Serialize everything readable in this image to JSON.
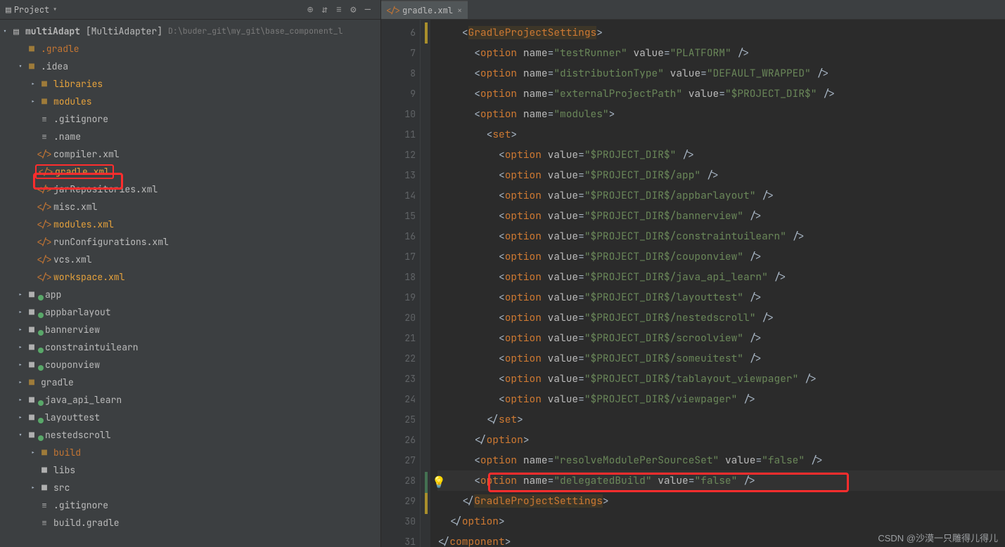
{
  "project_panel": {
    "title": "Project",
    "toolbar_icons": [
      "target-icon",
      "sort-icon",
      "collapse-icon",
      "gear-icon",
      "hide-icon"
    ],
    "root": {
      "name": "multiAdapt",
      "bracket": "[MultiAdapter]",
      "path": "D:\\buder_git\\my_git\\base_component_l"
    },
    "tree": [
      {
        "depth": 1,
        "arrow": "",
        "icon": "fold",
        "label": ".gradle",
        "cls": "org"
      },
      {
        "depth": 1,
        "arrow": "v",
        "icon": "fold",
        "label": ".idea",
        "cls": ""
      },
      {
        "depth": 2,
        "arrow": ">",
        "icon": "fold",
        "label": "libraries",
        "cls": "sel"
      },
      {
        "depth": 2,
        "arrow": ">",
        "icon": "fold",
        "label": "modules",
        "cls": "sel"
      },
      {
        "depth": 2,
        "arrow": "",
        "icon": "txt",
        "label": ".gitignore",
        "cls": ""
      },
      {
        "depth": 2,
        "arrow": "",
        "icon": "txt",
        "label": ".name",
        "cls": ""
      },
      {
        "depth": 2,
        "arrow": "",
        "icon": "xml",
        "label": "compiler.xml",
        "cls": ""
      },
      {
        "depth": 2,
        "arrow": "",
        "icon": "xml",
        "label": "gradle.xml",
        "cls": "sel",
        "boxed": true
      },
      {
        "depth": 2,
        "arrow": "",
        "icon": "xml",
        "label": "jarRepositories.xml",
        "cls": ""
      },
      {
        "depth": 2,
        "arrow": "",
        "icon": "xml",
        "label": "misc.xml",
        "cls": ""
      },
      {
        "depth": 2,
        "arrow": "",
        "icon": "xml",
        "label": "modules.xml",
        "cls": "sel"
      },
      {
        "depth": 2,
        "arrow": "",
        "icon": "xml",
        "label": "runConfigurations.xml",
        "cls": ""
      },
      {
        "depth": 2,
        "arrow": "",
        "icon": "xml",
        "label": "vcs.xml",
        "cls": ""
      },
      {
        "depth": 2,
        "arrow": "",
        "icon": "xml",
        "label": "workspace.xml",
        "cls": "sel"
      },
      {
        "depth": 1,
        "arrow": ">",
        "icon": "foldg",
        "label": "app",
        "cls": ""
      },
      {
        "depth": 1,
        "arrow": ">",
        "icon": "foldg",
        "label": "appbarlayout",
        "cls": ""
      },
      {
        "depth": 1,
        "arrow": ">",
        "icon": "foldg",
        "label": "bannerview",
        "cls": ""
      },
      {
        "depth": 1,
        "arrow": ">",
        "icon": "foldg",
        "label": "constraintuilearn",
        "cls": ""
      },
      {
        "depth": 1,
        "arrow": ">",
        "icon": "foldg",
        "label": "couponview",
        "cls": ""
      },
      {
        "depth": 1,
        "arrow": ">",
        "icon": "fold",
        "label": "gradle",
        "cls": ""
      },
      {
        "depth": 1,
        "arrow": ">",
        "icon": "foldg",
        "label": "java_api_learn",
        "cls": ""
      },
      {
        "depth": 1,
        "arrow": ">",
        "icon": "foldg",
        "label": "layouttest",
        "cls": ""
      },
      {
        "depth": 1,
        "arrow": "v",
        "icon": "foldg",
        "label": "nestedscroll",
        "cls": ""
      },
      {
        "depth": 2,
        "arrow": ">",
        "icon": "fold",
        "label": "build",
        "cls": "org"
      },
      {
        "depth": 2,
        "arrow": "",
        "icon": "foldb",
        "label": "libs",
        "cls": ""
      },
      {
        "depth": 2,
        "arrow": ">",
        "icon": "foldb",
        "label": "src",
        "cls": ""
      },
      {
        "depth": 2,
        "arrow": "",
        "icon": "txt",
        "label": ".gitignore",
        "cls": ""
      },
      {
        "depth": 2,
        "arrow": "",
        "icon": "txt",
        "label": "build.gradle",
        "cls": ""
      }
    ]
  },
  "editor": {
    "tab": {
      "label": "gradle.xml"
    },
    "first_line": 6,
    "lines": [
      {
        "html": "<span class='b'>&lt;</span><span class='t hlbg'>GradleProjectSettings</span><span class='b'>&gt;</span>",
        "indent": 2
      },
      {
        "html": "<span class='b'>&lt;</span><span class='t'>option </span><span class='a'>name</span><span class='eq'>=</span><span class='s'>\"testRunner\"</span> <span class='a'>value</span><span class='eq'>=</span><span class='s'>\"PLATFORM\"</span> <span class='b'>/&gt;</span>",
        "indent": 3
      },
      {
        "html": "<span class='b'>&lt;</span><span class='t'>option </span><span class='a'>name</span><span class='eq'>=</span><span class='s'>\"distributionType\"</span> <span class='a'>value</span><span class='eq'>=</span><span class='s'>\"DEFAULT_WRAPPED\"</span> <span class='b'>/&gt;</span>",
        "indent": 3
      },
      {
        "html": "<span class='b'>&lt;</span><span class='t'>option </span><span class='a'>name</span><span class='eq'>=</span><span class='s'>\"externalProjectPath\"</span> <span class='a'>value</span><span class='eq'>=</span><span class='s'>\"$PROJECT_DIR$\"</span> <span class='b'>/&gt;</span>",
        "indent": 3
      },
      {
        "html": "<span class='b'>&lt;</span><span class='t'>option </span><span class='a'>name</span><span class='eq'>=</span><span class='s'>\"modules\"</span><span class='b'>&gt;</span>",
        "indent": 3
      },
      {
        "html": "<span class='b'>&lt;</span><span class='t'>set</span><span class='b'>&gt;</span>",
        "indent": 4
      },
      {
        "html": "<span class='b'>&lt;</span><span class='t'>option </span><span class='a'>value</span><span class='eq'>=</span><span class='s'>\"$PROJECT_DIR$\"</span> <span class='b'>/&gt;</span>",
        "indent": 5
      },
      {
        "html": "<span class='b'>&lt;</span><span class='t'>option </span><span class='a'>value</span><span class='eq'>=</span><span class='s'>\"$PROJECT_DIR$/app\"</span> <span class='b'>/&gt;</span>",
        "indent": 5
      },
      {
        "html": "<span class='b'>&lt;</span><span class='t'>option </span><span class='a'>value</span><span class='eq'>=</span><span class='s'>\"$PROJECT_DIR$/appbarlayout\"</span> <span class='b'>/&gt;</span>",
        "indent": 5
      },
      {
        "html": "<span class='b'>&lt;</span><span class='t'>option </span><span class='a'>value</span><span class='eq'>=</span><span class='s'>\"$PROJECT_DIR$/bannerview\"</span> <span class='b'>/&gt;</span>",
        "indent": 5
      },
      {
        "html": "<span class='b'>&lt;</span><span class='t'>option </span><span class='a'>value</span><span class='eq'>=</span><span class='s'>\"$PROJECT_DIR$/constraintuilearn\"</span> <span class='b'>/&gt;</span>",
        "indent": 5
      },
      {
        "html": "<span class='b'>&lt;</span><span class='t'>option </span><span class='a'>value</span><span class='eq'>=</span><span class='s'>\"$PROJECT_DIR$/couponview\"</span> <span class='b'>/&gt;</span>",
        "indent": 5
      },
      {
        "html": "<span class='b'>&lt;</span><span class='t'>option </span><span class='a'>value</span><span class='eq'>=</span><span class='s'>\"$PROJECT_DIR$/java_api_learn\"</span> <span class='b'>/&gt;</span>",
        "indent": 5
      },
      {
        "html": "<span class='b'>&lt;</span><span class='t'>option </span><span class='a'>value</span><span class='eq'>=</span><span class='s'>\"$PROJECT_DIR$/layouttest\"</span> <span class='b'>/&gt;</span>",
        "indent": 5
      },
      {
        "html": "<span class='b'>&lt;</span><span class='t'>option </span><span class='a'>value</span><span class='eq'>=</span><span class='s'>\"$PROJECT_DIR$/nestedscroll\"</span> <span class='b'>/&gt;</span>",
        "indent": 5
      },
      {
        "html": "<span class='b'>&lt;</span><span class='t'>option </span><span class='a'>value</span><span class='eq'>=</span><span class='s'>\"$PROJECT_DIR$/scroolview\"</span> <span class='b'>/&gt;</span>",
        "indent": 5
      },
      {
        "html": "<span class='b'>&lt;</span><span class='t'>option </span><span class='a'>value</span><span class='eq'>=</span><span class='s'>\"$PROJECT_DIR$/someuitest\"</span> <span class='b'>/&gt;</span>",
        "indent": 5
      },
      {
        "html": "<span class='b'>&lt;</span><span class='t'>option </span><span class='a'>value</span><span class='eq'>=</span><span class='s'>\"$PROJECT_DIR$/tablayout_viewpager\"</span> <span class='b'>/&gt;</span>",
        "indent": 5
      },
      {
        "html": "<span class='b'>&lt;</span><span class='t'>option </span><span class='a'>value</span><span class='eq'>=</span><span class='s'>\"$PROJECT_DIR$/viewpager\"</span> <span class='b'>/&gt;</span>",
        "indent": 5
      },
      {
        "html": "<span class='b'>&lt;/</span><span class='t'>set</span><span class='b'>&gt;</span>",
        "indent": 4
      },
      {
        "html": "<span class='b'>&lt;/</span><span class='t'>option</span><span class='b'>&gt;</span>",
        "indent": 3
      },
      {
        "html": "<span class='b'>&lt;</span><span class='t'>option </span><span class='a'>name</span><span class='eq'>=</span><span class='s'>\"resolveModulePerSourceSet\"</span> <span class='a'>value</span><span class='eq'>=</span><span class='s'>\"false\"</span> <span class='b'>/&gt;</span>",
        "indent": 3
      },
      {
        "html": "<span class='b'>&lt;</span><span class='t'>option </span><span class='a'>name</span><span class='eq'>=</span><span class='s'>\"delegatedBuild\"</span> <span class='a'>value</span><span class='eq'>=</span><span class='s'>\"false\"</span> <span class='b'>/&gt;</span>",
        "indent": 3,
        "current": true
      },
      {
        "html": "<span class='b'>&lt;/</span><span class='t hlbg'>GradleProjectSettings</span><span class='b'>&gt;</span>",
        "indent": 2
      },
      {
        "html": "<span class='b'>&lt;/</span><span class='t'>option</span><span class='b'>&gt;</span>",
        "indent": 1
      },
      {
        "html": "<span class='b'>&lt;/</span><span class='t'>component</span><span class='b'>&gt;</span>",
        "indent": 0,
        "partial": true
      }
    ]
  },
  "watermark": "CSDN @沙漠一只雕得儿得儿"
}
